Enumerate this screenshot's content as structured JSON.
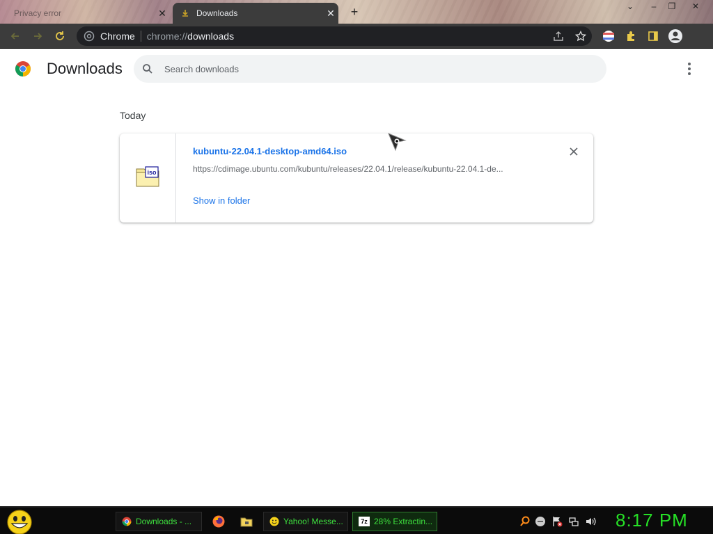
{
  "tabs": [
    {
      "title": "Privacy error",
      "close_label": "✕",
      "active": false
    },
    {
      "title": "Downloads",
      "close_label": "✕",
      "active": true
    }
  ],
  "new_tab_label": "+",
  "window_controls": {
    "dropdown": "⌄",
    "minimize": "–",
    "restore": "❐",
    "close": "✕"
  },
  "omnibox": {
    "site_label": "Chrome",
    "url_scheme": "chrome://",
    "url_host": "downloads"
  },
  "header": {
    "title": "Downloads",
    "search_placeholder": "Search downloads"
  },
  "download_list": {
    "date_heading": "Today",
    "items": [
      {
        "file_name": "kubuntu-22.04.1-desktop-amd64.iso",
        "url": "https://cdimage.ubuntu.com/kubuntu/releases/22.04.1/release/kubuntu-22.04.1-de...",
        "action_label": "Show in folder",
        "icon_badge": "iso",
        "icon": "iso-file-icon"
      }
    ]
  },
  "taskbar": {
    "buttons": [
      {
        "label": "Downloads - ...",
        "icon": "chrome-icon"
      },
      {
        "label": "Yahoo! Messe...",
        "icon": "smiley-icon"
      },
      {
        "label": "28% Extractin...",
        "icon": "7zip-icon",
        "icon_text": "7z"
      }
    ],
    "clock": "8:17 PM"
  },
  "colors": {
    "accent_link": "#1a73e8",
    "toolbar_bg": "#3c3c3c",
    "taskbar_text": "#3ee03e",
    "clock": "#26e026"
  }
}
